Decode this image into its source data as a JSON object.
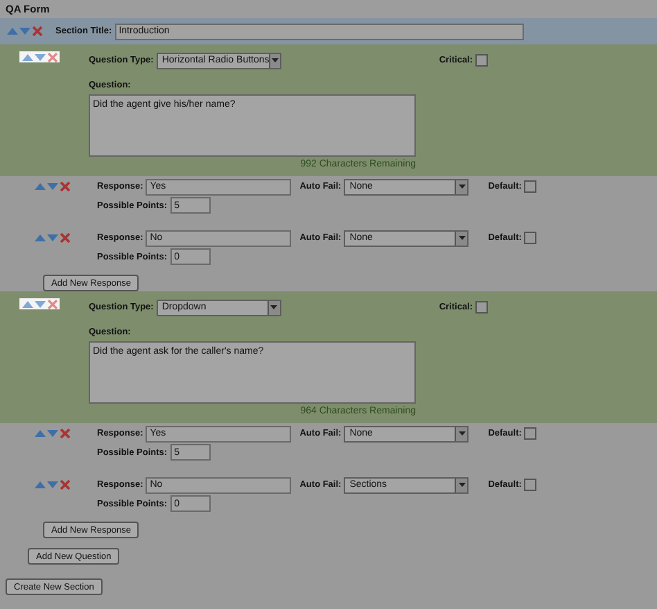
{
  "title": "QA Form",
  "section": {
    "title_label": "Section Title:",
    "title": "Introduction",
    "questions": [
      {
        "type_label": "Question Type:",
        "type": "Horizontal Radio Buttons",
        "critical_label": "Critical:",
        "critical": false,
        "question_label": "Question:",
        "question": "Did the agent give his/her name?",
        "remaining": "992 Characters Remaining",
        "responses": [
          {
            "response_label": "Response:",
            "response": "Yes",
            "auto_fail_label": "Auto Fail:",
            "auto_fail": "None",
            "default_label": "Default:",
            "default": false,
            "points_label": "Possible Points:",
            "points": "5"
          },
          {
            "response_label": "Response:",
            "response": "No",
            "auto_fail_label": "Auto Fail:",
            "auto_fail": "None",
            "default_label": "Default:",
            "default": false,
            "points_label": "Possible Points:",
            "points": "0"
          }
        ],
        "add_response": "Add New Response"
      },
      {
        "type_label": "Question Type:",
        "type": "Dropdown",
        "critical_label": "Critical:",
        "critical": false,
        "question_label": "Question:",
        "question": "Did the agent ask for the caller's name?",
        "remaining": "964 Characters Remaining",
        "responses": [
          {
            "response_label": "Response:",
            "response": "Yes",
            "auto_fail_label": "Auto Fail:",
            "auto_fail": "None",
            "default_label": "Default:",
            "default": false,
            "points_label": "Possible Points:",
            "points": "5"
          },
          {
            "response_label": "Response:",
            "response": "No",
            "auto_fail_label": "Auto Fail:",
            "auto_fail": "Sections",
            "default_label": "Default:",
            "default": false,
            "points_label": "Possible Points:",
            "points": "0"
          }
        ],
        "add_response": "Add New Response"
      }
    ]
  },
  "add_question": "Add New Question",
  "create_section": "Create New Section"
}
